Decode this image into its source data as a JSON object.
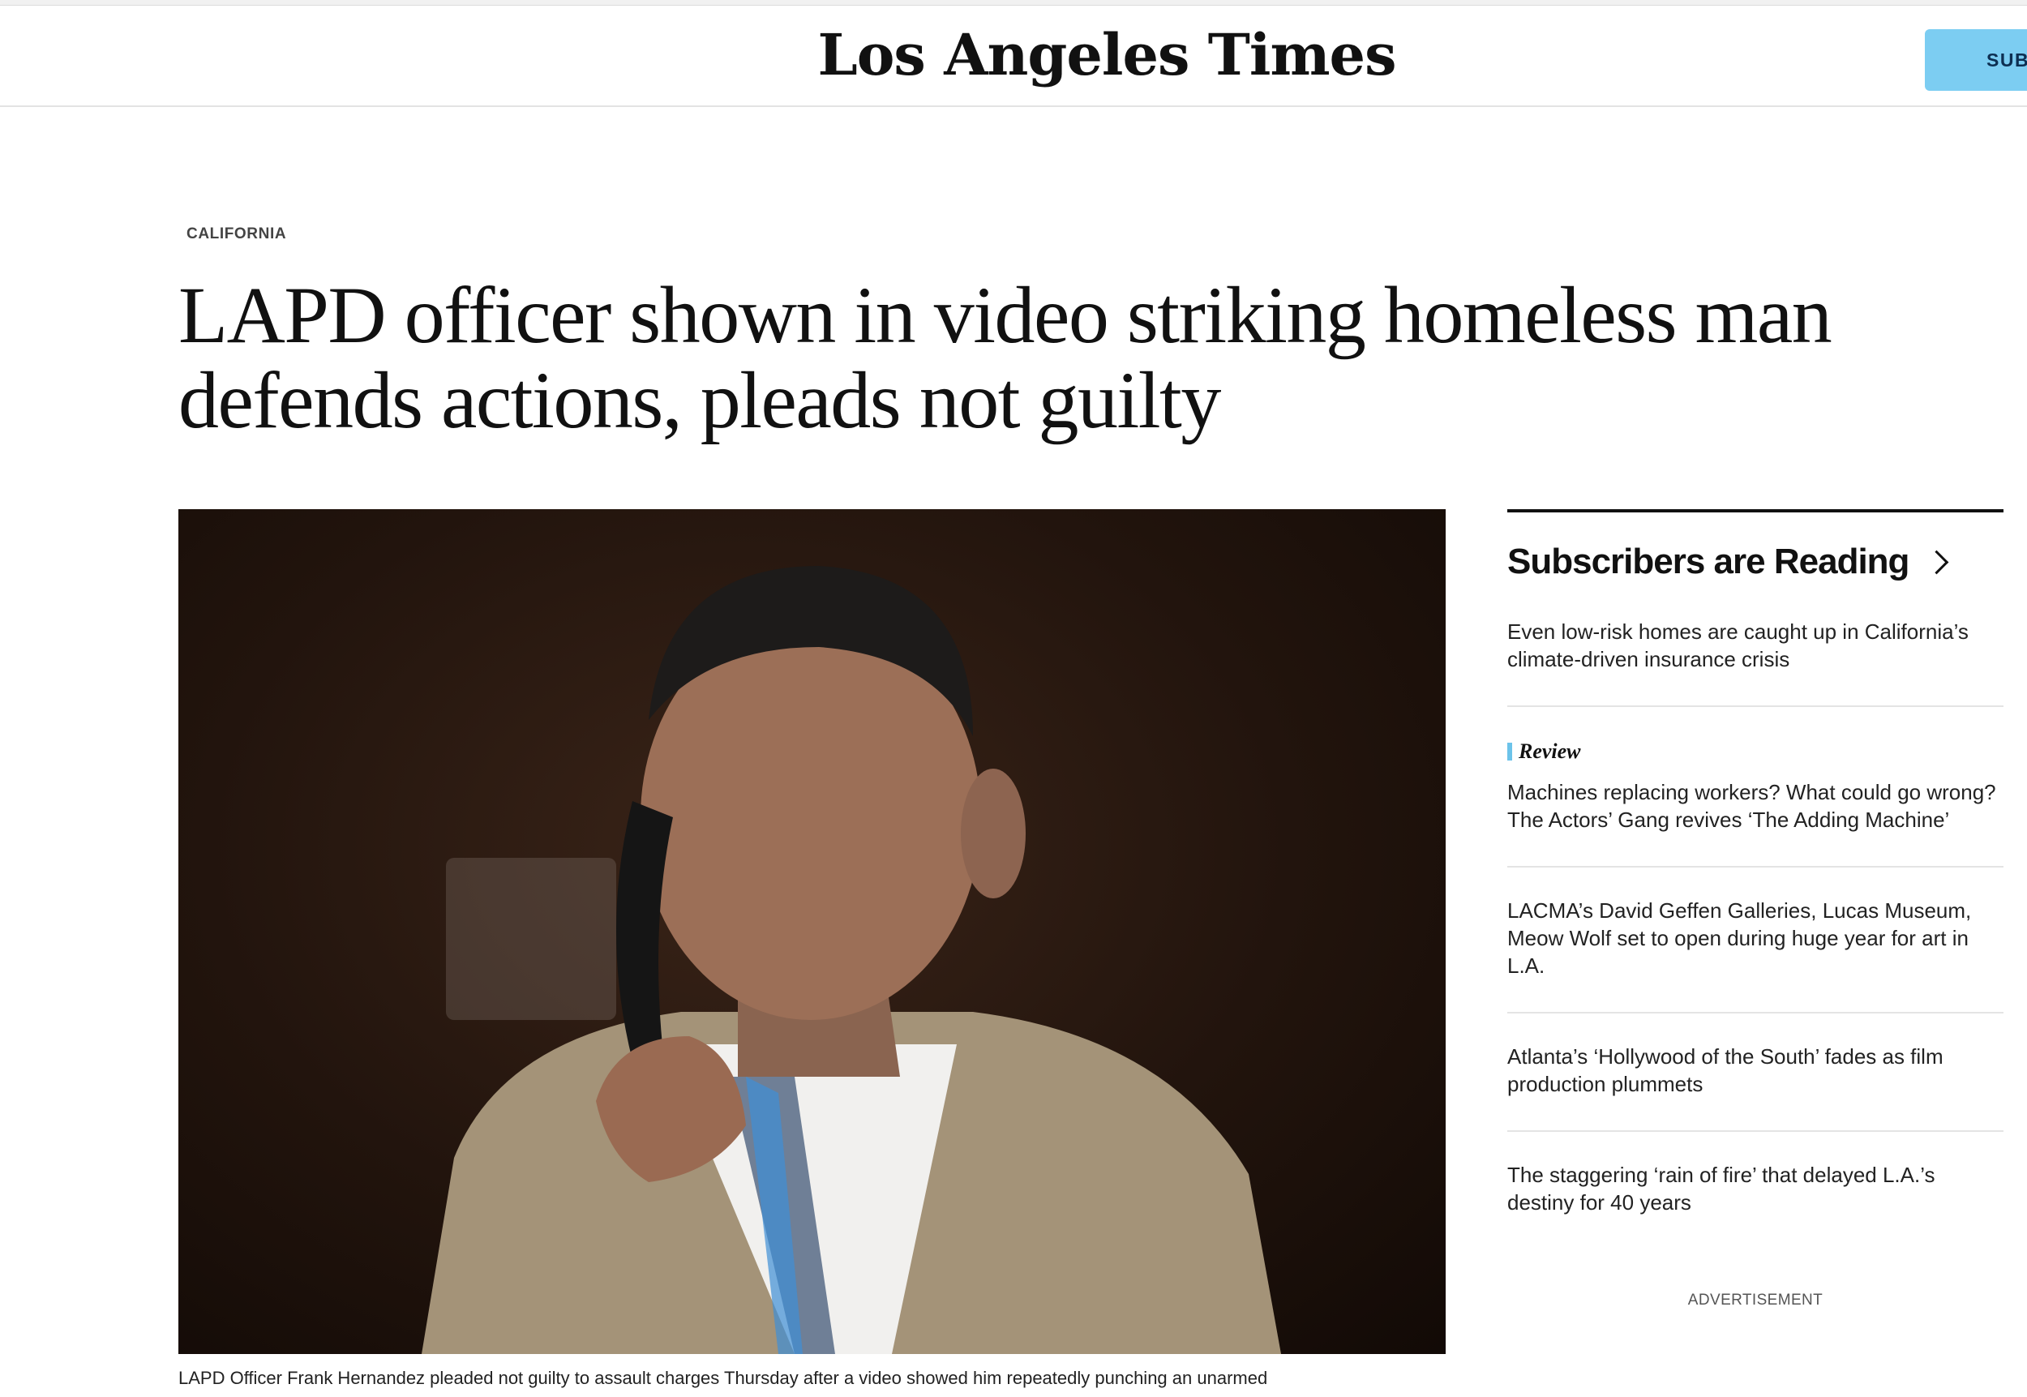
{
  "header": {
    "masthead": "Los Angeles Times",
    "subscribe_label": "SUB"
  },
  "article": {
    "section": "CALIFORNIA",
    "headline": "LAPD officer shown in video striking homeless man defends actions, pleads not guilty",
    "caption": "LAPD Officer Frank Hernandez pleaded not guilty to assault charges Thursday after a video showed him repeatedly punching an unarmed"
  },
  "sidebar": {
    "title": "Subscribers are Reading",
    "stories": [
      {
        "kicker": "",
        "text": "Even low-risk homes are caught up in California’s climate-driven insurance crisis"
      },
      {
        "kicker": "Review",
        "text": "Machines replacing workers? What could go wrong? The Actors’ Gang revives ‘The Adding Machine’"
      },
      {
        "kicker": "",
        "text": "LACMA’s David Geffen Galleries, Lucas Museum, Meow Wolf set to open during huge year for art in L.A."
      },
      {
        "kicker": "",
        "text": "Atlanta’s ‘Hollywood of the South’ fades as film production plummets"
      },
      {
        "kicker": "",
        "text": "The staggering ‘rain of fire’ that delayed L.A.’s destiny for 40 years"
      }
    ],
    "advertisement_label": "ADVERTISEMENT"
  },
  "colors": {
    "subscribe_button": "#7ccdf2",
    "kicker_accent": "#6cc3ea"
  }
}
